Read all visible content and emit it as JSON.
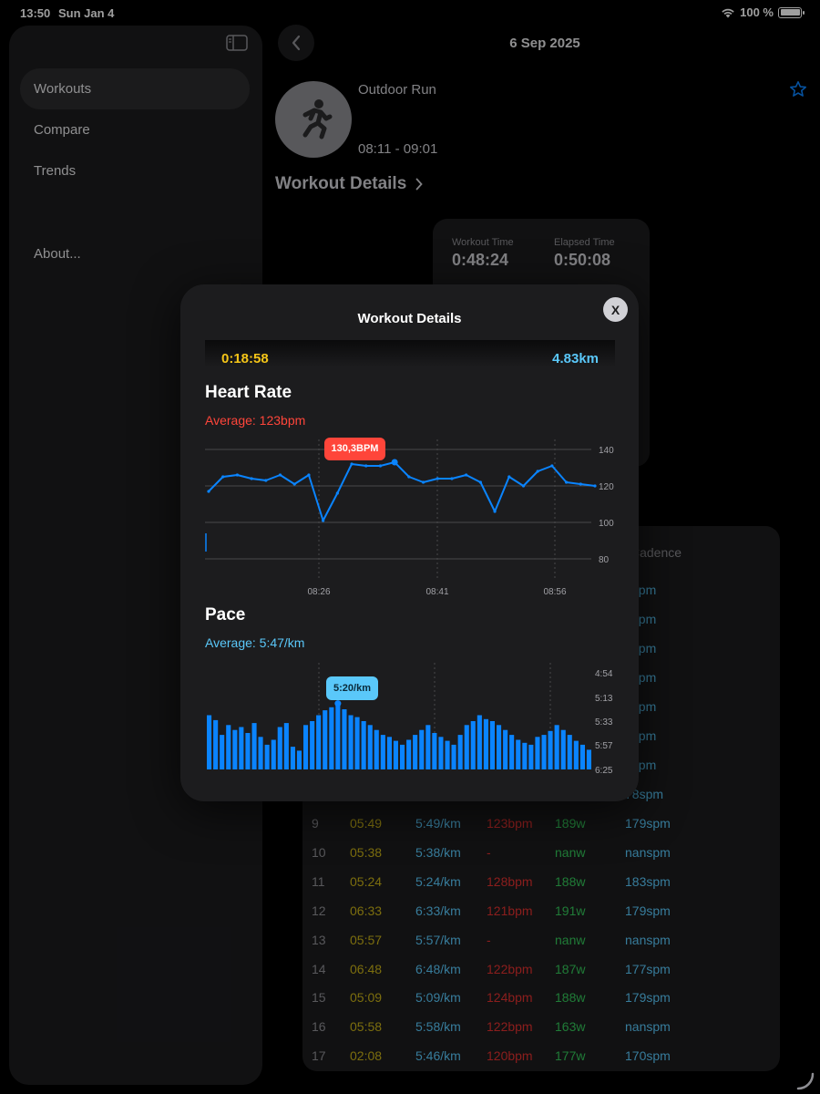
{
  "status_bar": {
    "time": "13:50",
    "date": "Sun Jan 4",
    "battery": "100 %",
    "battery_level": 1.0
  },
  "sidebar": {
    "items": [
      {
        "label": "Workouts",
        "active": true
      },
      {
        "label": "Compare",
        "active": false
      },
      {
        "label": "Trends",
        "active": false
      },
      {
        "label": "About...",
        "active": false
      }
    ]
  },
  "header": {
    "title": "6 Sep 2025"
  },
  "workout": {
    "type": "Outdoor Run",
    "time_range": "08:11 - 09:01",
    "details_link": "Workout Details"
  },
  "stats": {
    "workout_time_label": "Workout Time",
    "workout_time": "0:48:24",
    "elapsed_time_label": "Elapsed Time",
    "elapsed_time": "0:50:08"
  },
  "splits": {
    "cadence_header": "Cadence",
    "partial_cadence": [
      "4spm",
      "4spm",
      "nspm",
      "2spm",
      "1spm",
      "nspm",
      "1spm",
      "78spm"
    ],
    "rows": [
      {
        "num": "9",
        "time": "05:49",
        "pace": "5:49/km",
        "hr": "123bpm",
        "power": "189w",
        "cadence": "179spm"
      },
      {
        "num": "10",
        "time": "05:38",
        "pace": "5:38/km",
        "hr": "-",
        "power": "nanw",
        "cadence": "nanspm"
      },
      {
        "num": "11",
        "time": "05:24",
        "pace": "5:24/km",
        "hr": "128bpm",
        "power": "188w",
        "cadence": "183spm"
      },
      {
        "num": "12",
        "time": "06:33",
        "pace": "6:33/km",
        "hr": "121bpm",
        "power": "191w",
        "cadence": "179spm"
      },
      {
        "num": "13",
        "time": "05:57",
        "pace": "5:57/km",
        "hr": "-",
        "power": "nanw",
        "cadence": "nanspm"
      },
      {
        "num": "14",
        "time": "06:48",
        "pace": "6:48/km",
        "hr": "122bpm",
        "power": "187w",
        "cadence": "177spm"
      },
      {
        "num": "15",
        "time": "05:09",
        "pace": "5:09/km",
        "hr": "124bpm",
        "power": "188w",
        "cadence": "179spm"
      },
      {
        "num": "16",
        "time": "05:58",
        "pace": "5:58/km",
        "hr": "122bpm",
        "power": "163w",
        "cadence": "nanspm"
      },
      {
        "num": "17",
        "time": "02:08",
        "pace": "5:46/km",
        "hr": "120bpm",
        "power": "177w",
        "cadence": "170spm"
      }
    ]
  },
  "modal": {
    "title": "Workout Details",
    "close_label": "X",
    "summary_time": "0:18:58",
    "summary_distance": "4.83km",
    "heart_rate": {
      "title": "Heart Rate",
      "average": "Average: 123bpm",
      "callout": "130,3BPM",
      "color": "#0a84ff"
    },
    "pace": {
      "title": "Pace",
      "average": "Average: 5:47/km",
      "callout": "5:20/km",
      "color": "#0a84ff"
    }
  },
  "colors": {
    "accent_blue": "#0a84ff",
    "hr_red": "#ff453a",
    "time_yellow": "#f5c518",
    "pace_cyan": "#5ac8fa",
    "power_green": "#34c759"
  },
  "chart_data": [
    {
      "type": "line",
      "title": "Heart Rate",
      "ylabel": "",
      "ylim": [
        80,
        140
      ],
      "yticks": [
        "140",
        "120",
        "100",
        "80"
      ],
      "xticks": [
        "08:26",
        "08:41",
        "08:56"
      ],
      "series": [
        {
          "x": [
            "08:11",
            "08:13",
            "08:15",
            "08:17",
            "08:19",
            "08:21",
            "08:23",
            "08:25",
            "08:26",
            "08:27",
            "08:29",
            "08:31",
            "08:33",
            "08:35",
            "08:37",
            "08:39",
            "08:41",
            "08:43",
            "08:45",
            "08:47",
            "08:49",
            "08:51",
            "08:53",
            "08:55",
            "08:56",
            "08:58",
            "09:00",
            "09:01"
          ],
          "values": [
            117,
            125,
            126,
            124,
            123,
            126,
            121,
            126,
            101,
            116,
            132,
            131,
            131,
            133,
            125,
            122,
            124,
            124,
            126,
            122,
            106,
            125,
            120,
            128,
            131,
            122,
            121,
            120
          ]
        }
      ]
    },
    {
      "type": "bar",
      "title": "Pace",
      "ylabel": "",
      "yticks": [
        "4:54",
        "5:13",
        "5:33",
        "5:57",
        "6:25"
      ],
      "series": [
        {
          "values_seconds": [
            330,
            335,
            350,
            340,
            345,
            342,
            348,
            338,
            352,
            360,
            355,
            342,
            338,
            362,
            366,
            340,
            336,
            330,
            325,
            322,
            320,
            324,
            330,
            332,
            336,
            340,
            345,
            350,
            352,
            356,
            360,
            355,
            350,
            345,
            340,
            348,
            352,
            356,
            360,
            350,
            340,
            336,
            330,
            334,
            336,
            340,
            345,
            350,
            355,
            358,
            360,
            352,
            350,
            346,
            340,
            345,
            350,
            356,
            360,
            365
          ]
        }
      ]
    }
  ]
}
